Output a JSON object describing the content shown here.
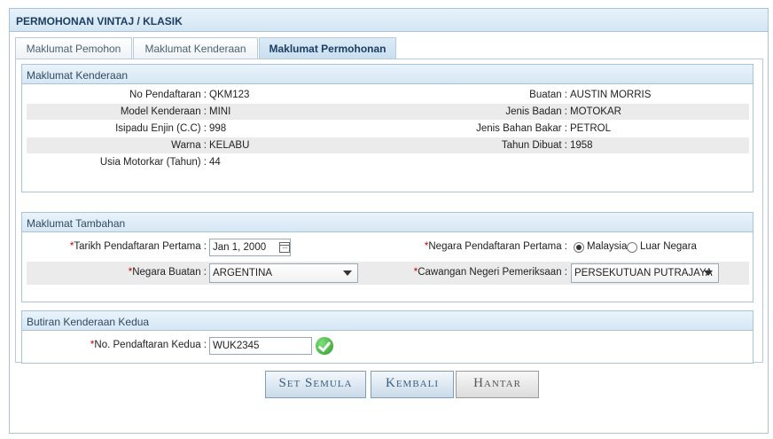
{
  "window": {
    "title": "PERMOHONAN VINTAJ / KLASIK"
  },
  "tabs": [
    {
      "label": "Maklumat Pemohon"
    },
    {
      "label": "Maklumat Kenderaan"
    },
    {
      "label": "Maklumat Permohonan"
    }
  ],
  "kenderaan": {
    "title": "Maklumat Kenderaan",
    "no_pendaftaran": {
      "label": "No Pendaftaran :",
      "value": "QKM123"
    },
    "buatan": {
      "label": "Buatan :",
      "value": "AUSTIN MORRIS"
    },
    "model": {
      "label": "Model Kenderaan :",
      "value": "MINI"
    },
    "jenis_badan": {
      "label": "Jenis Badan :",
      "value": "MOTOKAR"
    },
    "isipadu": {
      "label": "Isipadu Enjin (C.C) :",
      "value": "998"
    },
    "jenis_bahan_bakar": {
      "label": "Jenis Bahan Bakar :",
      "value": "PETROL"
    },
    "warna": {
      "label": "Warna :",
      "value": "KELABU"
    },
    "tahun_dibuat": {
      "label": "Tahun Dibuat :",
      "value": "1958"
    },
    "usia": {
      "label": "Usia Motorkar (Tahun) :",
      "value": "44"
    }
  },
  "tambahan": {
    "title": "Maklumat Tambahan",
    "required_mark": "*",
    "tarikh_pendaftaran": {
      "label": "Tarikh Pendaftaran Pertama :",
      "value": "Jan 1, 2000"
    },
    "negara_pendaftaran": {
      "label": "Negara Pendaftaran Pertama :",
      "option_malaysia": "Malaysia",
      "option_luar": "Luar Negara"
    },
    "negara_buatan": {
      "label": "Negara Buatan :",
      "value": "ARGENTINA"
    },
    "cawangan": {
      "label": "Cawangan Negeri Pemeriksaan :",
      "value": "PERSEKUTUAN PUTRAJAYA"
    }
  },
  "kedua": {
    "title": "Butiran Kenderaan Kedua",
    "required_mark": "*",
    "no_pendaftaran": {
      "label": "No. Pendaftaran Kedua :",
      "value": "WUK2345"
    }
  },
  "buttons": {
    "set_semula": "Set Semula",
    "kembali": "Kembali",
    "hantar": "Hantar"
  }
}
